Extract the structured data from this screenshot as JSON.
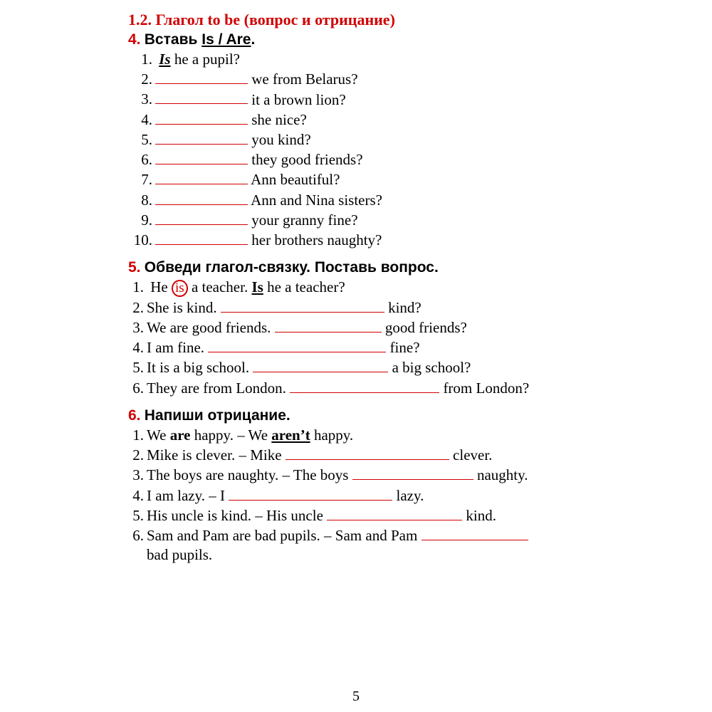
{
  "section_title": "1.2. Глагол to be (вопрос и отрицание)",
  "page_number": "5",
  "ex4": {
    "num": "4.",
    "instr_lead": "Вставь ",
    "instr_ul": "Is / Are",
    "instr_tail": ".",
    "item1n": "1.",
    "item1a": "Is",
    "item1b": " he a pupil?",
    "items": [
      {
        "n": "2.",
        "t": " we from Belarus?"
      },
      {
        "n": "3.",
        "t": " it a brown lion?"
      },
      {
        "n": "4.",
        "t": " she nice?"
      },
      {
        "n": "5.",
        "t": " you kind?"
      },
      {
        "n": "6.",
        "t": " they good friends?"
      },
      {
        "n": "7.",
        "t": " Ann beautiful?"
      },
      {
        "n": "8.",
        "t": " Ann and Nina sisters?"
      },
      {
        "n": "9.",
        "t": " your granny fine?"
      },
      {
        "n": "10.",
        "t": " her brothers naughty?"
      }
    ]
  },
  "ex5": {
    "num": "5.",
    "instr": "Обведи глагол-связку. Поставь вопрос.",
    "l1": {
      "n": "1.",
      "a": "He",
      "c": "is",
      "b": "a teacher. ",
      "q": "Is",
      "r": " he a teacher?"
    },
    "lines": [
      {
        "n": "2.",
        "a": "She is kind.  ",
        "t": "  kind?",
        "w": "w230"
      },
      {
        "n": "3.",
        "a": "We are good friends.   ",
        "t": " good friends?",
        "w": "w150"
      },
      {
        "n": "4.",
        "a": "I am fine.   ",
        "t": " fine?",
        "w": "w250"
      },
      {
        "n": "5.",
        "a": "It is a big school.  ",
        "t": " a big school?",
        "w": "w190"
      },
      {
        "n": "6.",
        "a": "They are from London.  ",
        "t": "  from London?",
        "w": "w210"
      }
    ]
  },
  "ex6": {
    "num": "6.",
    "instr": "Напиши отрицание.",
    "l1": {
      "n": "1.",
      "a": "We ",
      "b": "are",
      "c": " happy. – We ",
      "d": "aren’t",
      "e": " happy."
    },
    "lines": [
      {
        "n": "2.",
        "a": "Mike is clever. – Mike ",
        "t": " clever.",
        "w": "w230"
      },
      {
        "n": "3.",
        "a": "The boys are naughty. – The boys ",
        "t": " naughty.",
        "w": "w170"
      },
      {
        "n": "4.",
        "a": "I am lazy. – I ",
        "t": " lazy.",
        "w": "w230"
      },
      {
        "n": "5.",
        "a": "His uncle is kind. – His uncle ",
        "t": " kind.",
        "w": "w190"
      },
      {
        "n": "6.",
        "a": "Sam and Pam are bad pupils. – Sam and Pam ",
        "t": "",
        "w": "w150",
        "wrap": "bad pupils."
      }
    ]
  }
}
